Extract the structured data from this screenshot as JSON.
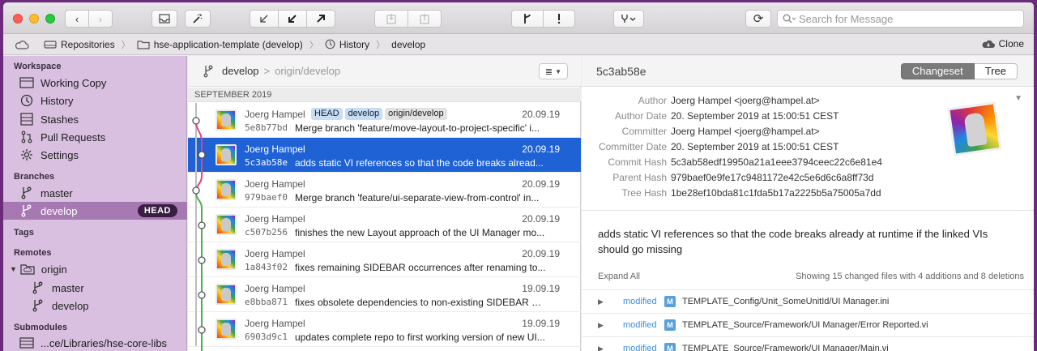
{
  "toolbar": {
    "back": "‹",
    "forward": "›",
    "search_placeholder": "Search for Message",
    "refresh": "⟳"
  },
  "breadcrumb": {
    "items": [
      {
        "label": "Repositories"
      },
      {
        "label": "hse-application-template (develop)"
      },
      {
        "label": "History"
      },
      {
        "label": "develop"
      }
    ],
    "clone_label": "Clone"
  },
  "sidebar": {
    "workspace_title": "Workspace",
    "workspace": [
      {
        "label": "Working Copy"
      },
      {
        "label": "History"
      },
      {
        "label": "Stashes"
      },
      {
        "label": "Pull Requests"
      },
      {
        "label": "Settings"
      }
    ],
    "branches_title": "Branches",
    "branches": [
      {
        "label": "master"
      },
      {
        "label": "develop",
        "badge": "HEAD"
      }
    ],
    "tags_title": "Tags",
    "remotes_title": "Remotes",
    "remote_name": "origin",
    "remote_branches": [
      {
        "label": "master"
      },
      {
        "label": "develop"
      }
    ],
    "submodules_title": "Submodules",
    "submodule": "...ce/Libraries/hse-core-libs"
  },
  "list": {
    "branch": "develop",
    "arrow": ">",
    "remote": "origin/develop",
    "month": "SEPTEMBER 2019",
    "commits": [
      {
        "author": "Joerg Hampel",
        "date": "20.09.19",
        "sha": "5e8b77bd",
        "message": "Merge branch 'feature/move-layout-to-project-specific' i...",
        "tags": [
          "HEAD",
          "develop",
          "origin/develop"
        ]
      },
      {
        "author": "Joerg Hampel",
        "date": "20.09.19",
        "sha": "5c3ab58e",
        "message": "adds static VI references so that the code breaks alread...",
        "tags": []
      },
      {
        "author": "Joerg Hampel",
        "date": "20.09.19",
        "sha": "979baef0",
        "message": "Merge branch 'feature/ui-separate-view-from-control' in...",
        "tags": []
      },
      {
        "author": "Joerg Hampel",
        "date": "20.09.19",
        "sha": "c507b256",
        "message": "finishes the new Layout approach of the UI Manager mo...",
        "tags": []
      },
      {
        "author": "Joerg Hampel",
        "date": "20.09.19",
        "sha": "1a843f02",
        "message": "fixes remaining SIDEBAR occurrences after renaming to...",
        "tags": []
      },
      {
        "author": "Joerg Hampel",
        "date": "19.09.19",
        "sha": "e8bba871",
        "message": "fixes obsolete dependencies to non-existing SIDEBAR m...",
        "tags": []
      },
      {
        "author": "Joerg Hampel",
        "date": "19.09.19",
        "sha": "6903d9c1",
        "message": "updates complete repo to first working version of new UI...",
        "tags": []
      }
    ]
  },
  "detail": {
    "sha": "5c3ab58e",
    "tab_changeset": "Changeset",
    "tab_tree": "Tree",
    "meta": [
      {
        "label": "Author",
        "value": "Joerg Hampel <joerg@hampel.at>"
      },
      {
        "label": "Author Date",
        "value": "20. September 2019 at 15:00:51 CEST"
      },
      {
        "label": "Committer",
        "value": "Joerg Hampel <joerg@hampel.at>"
      },
      {
        "label": "Committer Date",
        "value": "20. September 2019 at 15:00:51 CEST"
      },
      {
        "label": "Commit Hash",
        "value": "5c3ab58edf19950a21a1eee3794ceec22c6e81e4"
      },
      {
        "label": "Parent Hash",
        "value": "979baef0e9fe17c9481172e42c5e6d6c6a8ff73d"
      },
      {
        "label": "Tree Hash",
        "value": "1be28ef10bda81c1fda5b17a2225b5a75005a7dd"
      }
    ],
    "message": "adds static VI references so that the code breaks already at runtime if the linked VIs should go missing",
    "expand_all": "Expand All",
    "showing": "Showing 15 changed files with 4 additions and 8 deletions",
    "files": [
      {
        "status": "modified",
        "badge": "M",
        "path": "TEMPLATE_Config/Unit_SomeUnitId/UI Manager.ini"
      },
      {
        "status": "modified",
        "badge": "M",
        "path": "TEMPLATE_Source/Framework/UI Manager/Error Reported.vi"
      },
      {
        "status": "modified",
        "badge": "M",
        "path": "TEMPLATE_Source/Framework/UI Manager/Main.vi"
      }
    ]
  }
}
